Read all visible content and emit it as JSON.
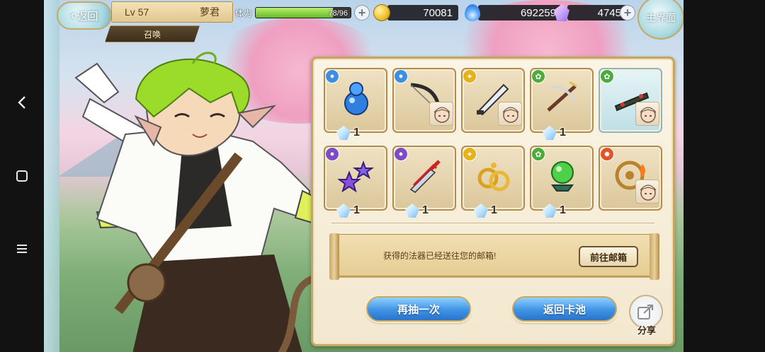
{
  "top_bar": {
    "back_label": "返回",
    "level": "Lv 57",
    "player_name": "萝君",
    "mode_tag": "召唤",
    "stamina_label": "体力",
    "stamina_value": "78/96",
    "stamina_fraction": 0.8125,
    "gold": "70081",
    "spirit": "692259",
    "gems": "4745",
    "home_label": "主界面"
  },
  "items": [
    {
      "element": "water",
      "element_color": "#3f8fe0",
      "item_icon": "blue-gourd",
      "has_portrait": false,
      "count": "1",
      "rare": false
    },
    {
      "element": "water",
      "element_color": "#3f8fe0",
      "item_icon": "dark-bow",
      "has_portrait": true,
      "count": "",
      "rare": false
    },
    {
      "element": "light",
      "element_color": "#e6b21a",
      "item_icon": "silver-blade",
      "has_portrait": true,
      "count": "",
      "rare": false
    },
    {
      "element": "wind",
      "element_color": "#4cab3a",
      "item_icon": "crossbow",
      "has_portrait": false,
      "count": "1",
      "rare": false
    },
    {
      "element": "wind",
      "element_color": "#4cab3a",
      "item_icon": "thorn-crown",
      "has_portrait": true,
      "count": "",
      "rare": true
    },
    {
      "element": "dark",
      "element_color": "#7d4cc2",
      "item_icon": "purple-stars",
      "has_portrait": false,
      "count": "1",
      "rare": false
    },
    {
      "element": "dark",
      "element_color": "#7d4cc2",
      "item_icon": "twin-daggers",
      "has_portrait": false,
      "count": "1",
      "rare": false
    },
    {
      "element": "light",
      "element_color": "#e6b21a",
      "item_icon": "gold-rings",
      "has_portrait": false,
      "count": "1",
      "rare": false
    },
    {
      "element": "wind",
      "element_color": "#4cab3a",
      "item_icon": "green-orb",
      "has_portrait": false,
      "count": "1",
      "rare": false
    },
    {
      "element": "fire",
      "element_color": "#e0542a",
      "item_icon": "fire-wheel",
      "has_portrait": true,
      "count": "",
      "rare": false
    }
  ],
  "notice": {
    "message": "获得的法器已经送往您的邮箱!",
    "mailbox_button": "前往邮箱"
  },
  "actions": {
    "draw_again": "再抽一次",
    "back_to_pool": "返回卡池",
    "share": "分享"
  }
}
